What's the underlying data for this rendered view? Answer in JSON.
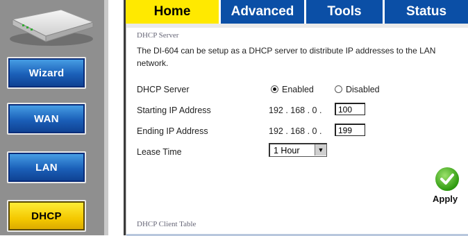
{
  "nav": {
    "items": [
      {
        "label": "Wizard"
      },
      {
        "label": "WAN"
      },
      {
        "label": "LAN"
      },
      {
        "label": "DHCP"
      }
    ]
  },
  "tabs": [
    {
      "label": "Home"
    },
    {
      "label": "Advanced"
    },
    {
      "label": "Tools"
    },
    {
      "label": "Status"
    }
  ],
  "dhcp": {
    "section_title": "DHCP Server",
    "description": "The DI-604 can be setup as a DHCP server to distribute IP addresses to the LAN network.",
    "server_label": "DHCP Server",
    "enabled_label": "Enabled",
    "disabled_label": "Disabled",
    "enabled": true,
    "start_label": "Starting IP Address",
    "start_prefix": "192 . 168 . 0 .",
    "start_value": "100",
    "end_label": "Ending IP Address",
    "end_prefix": "192 . 168 . 0 .",
    "end_value": "199",
    "lease_label": "Lease Time",
    "lease_value": "1 Hour",
    "apply_label": "Apply",
    "client_table_title": "DHCP Client Table"
  },
  "colors": {
    "tab_bar": "#0b4fa6",
    "tab_active": "#ffe900",
    "nav_blue": "#1b5fb8",
    "nav_active": "#f4c800",
    "rail": "#8f8f8f"
  }
}
